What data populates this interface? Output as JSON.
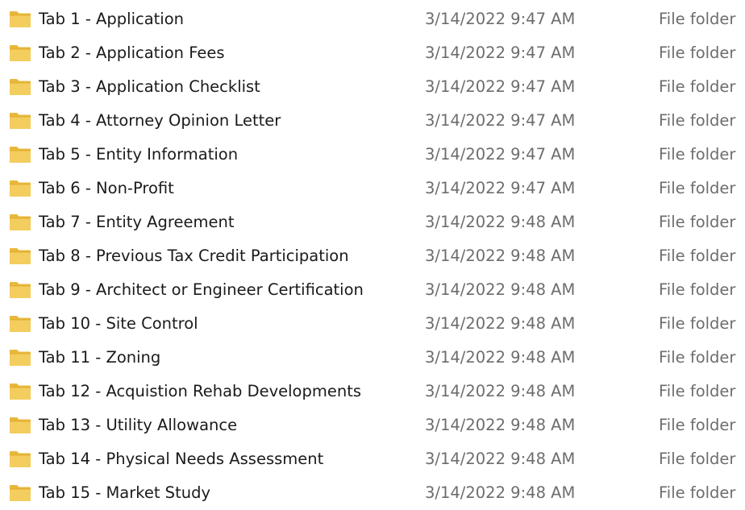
{
  "colors": {
    "folder_fill": "#f3cd5d",
    "folder_tab": "#e0ae2f",
    "folder_back": "#e8b83c",
    "text_primary": "#1a1a1a",
    "text_secondary": "#6d6d6d"
  },
  "file_list": {
    "rows": [
      {
        "name": "Tab 1 - Application",
        "date_modified": "3/14/2022 9:47 AM",
        "type": "File folder",
        "icon": "folder-icon"
      },
      {
        "name": "Tab 2 - Application Fees",
        "date_modified": "3/14/2022 9:47 AM",
        "type": "File folder",
        "icon": "folder-icon"
      },
      {
        "name": "Tab 3 - Application Checklist",
        "date_modified": "3/14/2022 9:47 AM",
        "type": "File folder",
        "icon": "folder-icon"
      },
      {
        "name": "Tab 4 - Attorney Opinion Letter",
        "date_modified": "3/14/2022 9:47 AM",
        "type": "File folder",
        "icon": "folder-icon"
      },
      {
        "name": "Tab 5 - Entity Information",
        "date_modified": "3/14/2022 9:47 AM",
        "type": "File folder",
        "icon": "folder-icon"
      },
      {
        "name": "Tab 6 - Non-Profit",
        "date_modified": "3/14/2022 9:47 AM",
        "type": "File folder",
        "icon": "folder-icon"
      },
      {
        "name": "Tab 7 - Entity Agreement",
        "date_modified": "3/14/2022 9:48 AM",
        "type": "File folder",
        "icon": "folder-icon"
      },
      {
        "name": "Tab 8 - Previous Tax Credit Participation",
        "date_modified": "3/14/2022 9:48 AM",
        "type": "File folder",
        "icon": "folder-icon"
      },
      {
        "name": "Tab 9 - Architect or Engineer Certification",
        "date_modified": "3/14/2022 9:48 AM",
        "type": "File folder",
        "icon": "folder-icon"
      },
      {
        "name": "Tab 10 - Site Control",
        "date_modified": "3/14/2022 9:48 AM",
        "type": "File folder",
        "icon": "folder-icon"
      },
      {
        "name": "Tab 11 - Zoning",
        "date_modified": "3/14/2022 9:48 AM",
        "type": "File folder",
        "icon": "folder-icon"
      },
      {
        "name": "Tab 12 - Acquistion Rehab Developments",
        "date_modified": "3/14/2022 9:48 AM",
        "type": "File folder",
        "icon": "folder-icon"
      },
      {
        "name": "Tab 13 - Utility Allowance",
        "date_modified": "3/14/2022 9:48 AM",
        "type": "File folder",
        "icon": "folder-icon"
      },
      {
        "name": "Tab 14 - Physical Needs Assessment",
        "date_modified": "3/14/2022 9:48 AM",
        "type": "File folder",
        "icon": "folder-icon"
      },
      {
        "name": "Tab 15 - Market Study",
        "date_modified": "3/14/2022 9:48 AM",
        "type": "File folder",
        "icon": "folder-icon"
      }
    ]
  }
}
